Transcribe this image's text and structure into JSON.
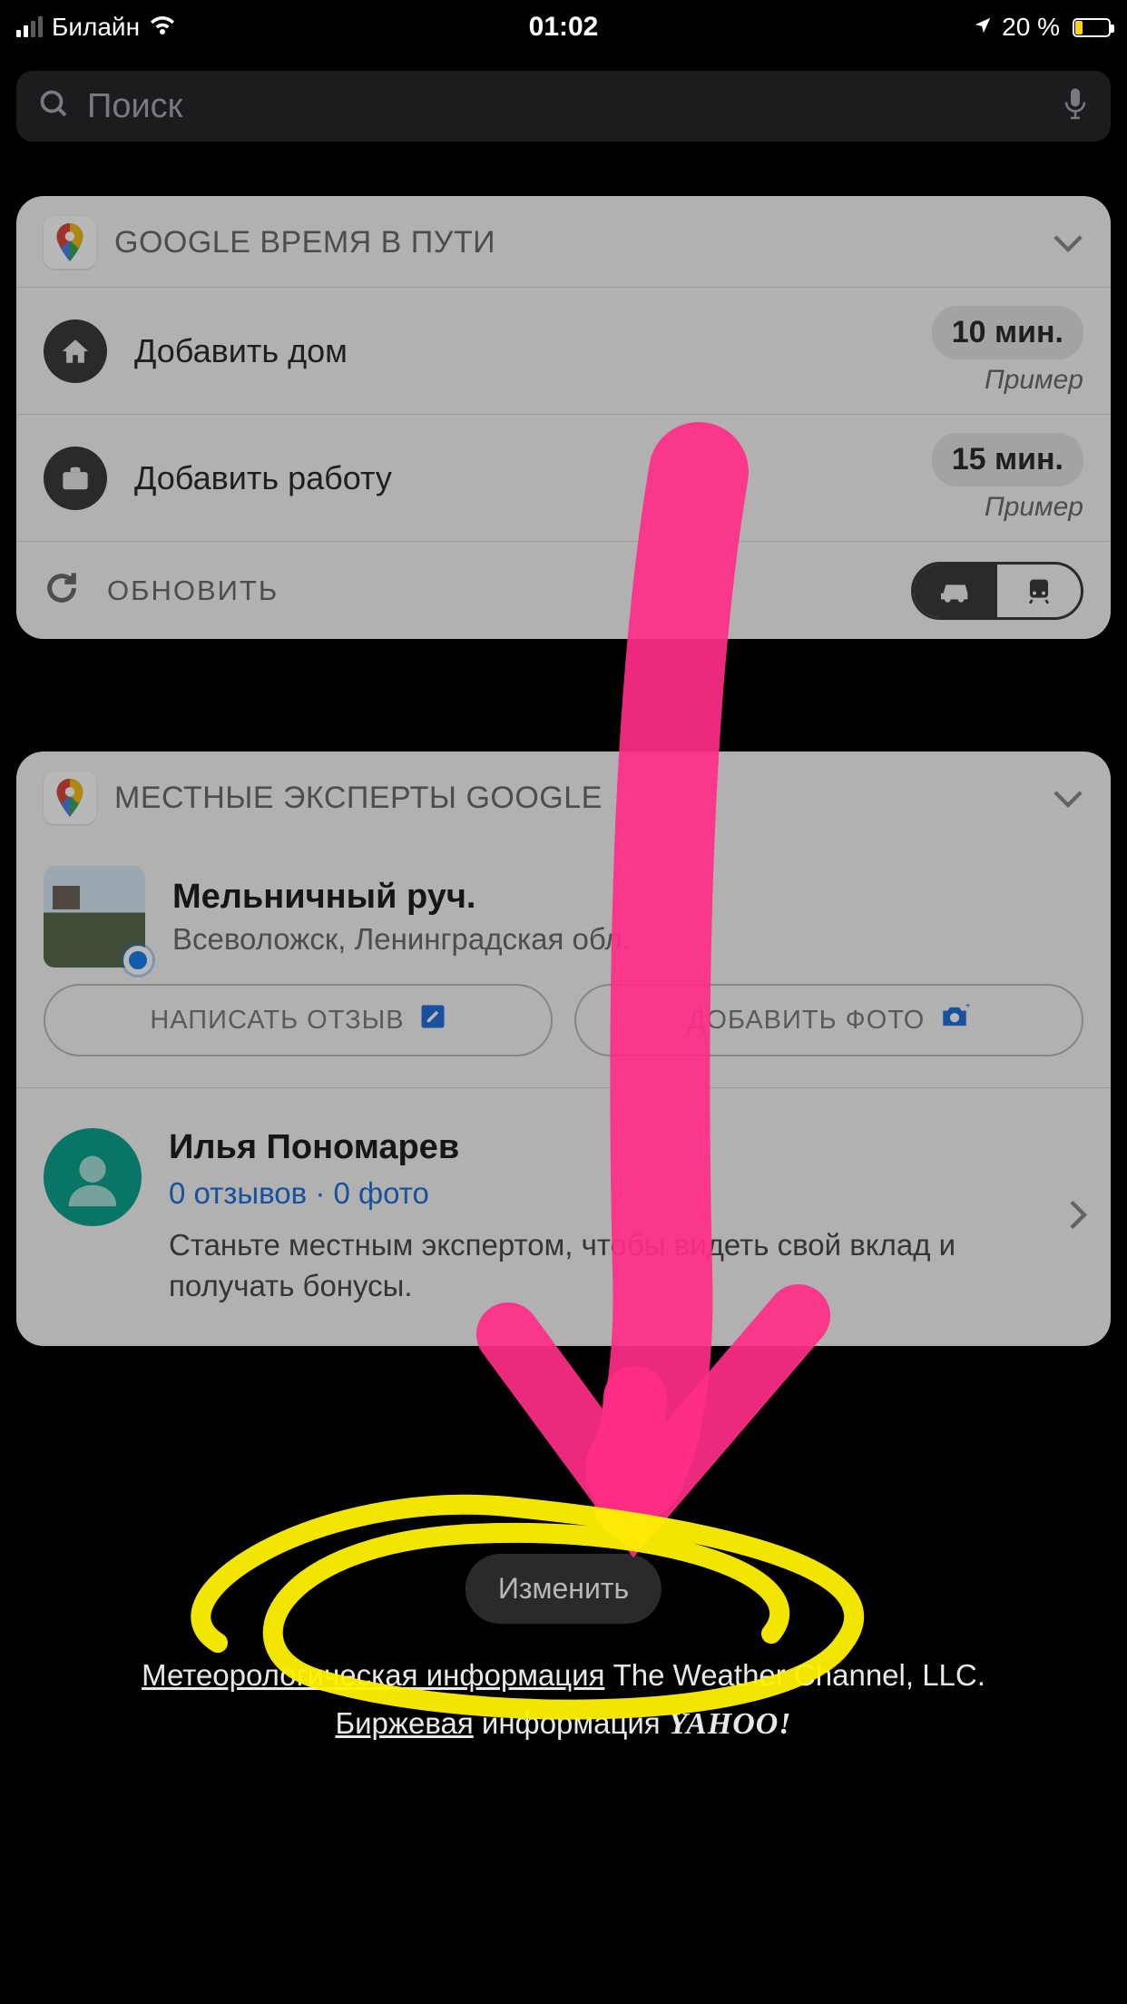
{
  "statusbar": {
    "carrier": "Билайн",
    "time": "01:02",
    "battery_pct": "20 %"
  },
  "search": {
    "placeholder": "Поиск"
  },
  "widget_travel": {
    "title": "GOOGLE ВРЕМЯ В ПУТИ",
    "home_label": "Добавить дом",
    "home_time": "10 мин.",
    "home_example": "Пример",
    "work_label": "Добавить работу",
    "work_time": "15 мин.",
    "work_example": "Пример",
    "refresh_label": "ОБНОВИТЬ"
  },
  "widget_local": {
    "title": "МЕСТНЫЕ ЭКСПЕРТЫ GOOGLE",
    "place_title": "Мельничный руч.",
    "place_sub": "Всеволожск, Ленинградская обл.",
    "review_btn": "НАПИСАТЬ ОТЗЫВ",
    "photo_btn": "ДОБАВИТЬ ФОТО",
    "user_name": "Илья Пономарев",
    "user_stats": "0 отзывов · 0 фото",
    "user_desc": "Станьте местным экспертом, чтобы видеть свой вклад и получать бонусы."
  },
  "edit_btn": "Изменить",
  "footer": {
    "weather_link": "Метеорологическая информация",
    "weather_rest": " The Weather Channel, LLC.",
    "stock_link": "Биржевая",
    "stock_rest": " информация ",
    "yahoo": "YAHOO!"
  }
}
